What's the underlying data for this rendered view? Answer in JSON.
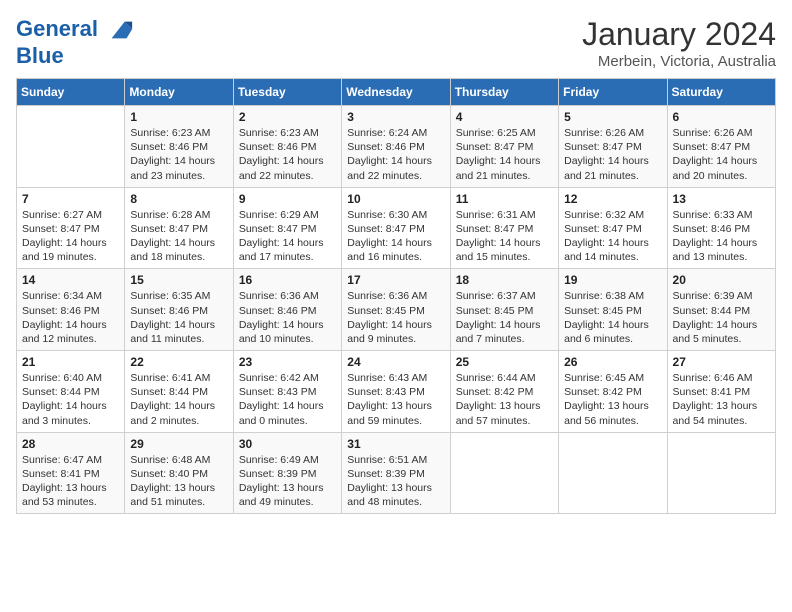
{
  "logo": {
    "line1": "General",
    "line2": "Blue"
  },
  "header": {
    "month": "January 2024",
    "location": "Merbein, Victoria, Australia"
  },
  "weekdays": [
    "Sunday",
    "Monday",
    "Tuesday",
    "Wednesday",
    "Thursday",
    "Friday",
    "Saturday"
  ],
  "weeks": [
    [
      {
        "day": "",
        "info": ""
      },
      {
        "day": "1",
        "info": "Sunrise: 6:23 AM\nSunset: 8:46 PM\nDaylight: 14 hours\nand 23 minutes."
      },
      {
        "day": "2",
        "info": "Sunrise: 6:23 AM\nSunset: 8:46 PM\nDaylight: 14 hours\nand 22 minutes."
      },
      {
        "day": "3",
        "info": "Sunrise: 6:24 AM\nSunset: 8:46 PM\nDaylight: 14 hours\nand 22 minutes."
      },
      {
        "day": "4",
        "info": "Sunrise: 6:25 AM\nSunset: 8:47 PM\nDaylight: 14 hours\nand 21 minutes."
      },
      {
        "day": "5",
        "info": "Sunrise: 6:26 AM\nSunset: 8:47 PM\nDaylight: 14 hours\nand 21 minutes."
      },
      {
        "day": "6",
        "info": "Sunrise: 6:26 AM\nSunset: 8:47 PM\nDaylight: 14 hours\nand 20 minutes."
      }
    ],
    [
      {
        "day": "7",
        "info": "Sunrise: 6:27 AM\nSunset: 8:47 PM\nDaylight: 14 hours\nand 19 minutes."
      },
      {
        "day": "8",
        "info": "Sunrise: 6:28 AM\nSunset: 8:47 PM\nDaylight: 14 hours\nand 18 minutes."
      },
      {
        "day": "9",
        "info": "Sunrise: 6:29 AM\nSunset: 8:47 PM\nDaylight: 14 hours\nand 17 minutes."
      },
      {
        "day": "10",
        "info": "Sunrise: 6:30 AM\nSunset: 8:47 PM\nDaylight: 14 hours\nand 16 minutes."
      },
      {
        "day": "11",
        "info": "Sunrise: 6:31 AM\nSunset: 8:47 PM\nDaylight: 14 hours\nand 15 minutes."
      },
      {
        "day": "12",
        "info": "Sunrise: 6:32 AM\nSunset: 8:47 PM\nDaylight: 14 hours\nand 14 minutes."
      },
      {
        "day": "13",
        "info": "Sunrise: 6:33 AM\nSunset: 8:46 PM\nDaylight: 14 hours\nand 13 minutes."
      }
    ],
    [
      {
        "day": "14",
        "info": "Sunrise: 6:34 AM\nSunset: 8:46 PM\nDaylight: 14 hours\nand 12 minutes."
      },
      {
        "day": "15",
        "info": "Sunrise: 6:35 AM\nSunset: 8:46 PM\nDaylight: 14 hours\nand 11 minutes."
      },
      {
        "day": "16",
        "info": "Sunrise: 6:36 AM\nSunset: 8:46 PM\nDaylight: 14 hours\nand 10 minutes."
      },
      {
        "day": "17",
        "info": "Sunrise: 6:36 AM\nSunset: 8:45 PM\nDaylight: 14 hours\nand 9 minutes."
      },
      {
        "day": "18",
        "info": "Sunrise: 6:37 AM\nSunset: 8:45 PM\nDaylight: 14 hours\nand 7 minutes."
      },
      {
        "day": "19",
        "info": "Sunrise: 6:38 AM\nSunset: 8:45 PM\nDaylight: 14 hours\nand 6 minutes."
      },
      {
        "day": "20",
        "info": "Sunrise: 6:39 AM\nSunset: 8:44 PM\nDaylight: 14 hours\nand 5 minutes."
      }
    ],
    [
      {
        "day": "21",
        "info": "Sunrise: 6:40 AM\nSunset: 8:44 PM\nDaylight: 14 hours\nand 3 minutes."
      },
      {
        "day": "22",
        "info": "Sunrise: 6:41 AM\nSunset: 8:44 PM\nDaylight: 14 hours\nand 2 minutes."
      },
      {
        "day": "23",
        "info": "Sunrise: 6:42 AM\nSunset: 8:43 PM\nDaylight: 14 hours\nand 0 minutes."
      },
      {
        "day": "24",
        "info": "Sunrise: 6:43 AM\nSunset: 8:43 PM\nDaylight: 13 hours\nand 59 minutes."
      },
      {
        "day": "25",
        "info": "Sunrise: 6:44 AM\nSunset: 8:42 PM\nDaylight: 13 hours\nand 57 minutes."
      },
      {
        "day": "26",
        "info": "Sunrise: 6:45 AM\nSunset: 8:42 PM\nDaylight: 13 hours\nand 56 minutes."
      },
      {
        "day": "27",
        "info": "Sunrise: 6:46 AM\nSunset: 8:41 PM\nDaylight: 13 hours\nand 54 minutes."
      }
    ],
    [
      {
        "day": "28",
        "info": "Sunrise: 6:47 AM\nSunset: 8:41 PM\nDaylight: 13 hours\nand 53 minutes."
      },
      {
        "day": "29",
        "info": "Sunrise: 6:48 AM\nSunset: 8:40 PM\nDaylight: 13 hours\nand 51 minutes."
      },
      {
        "day": "30",
        "info": "Sunrise: 6:49 AM\nSunset: 8:39 PM\nDaylight: 13 hours\nand 49 minutes."
      },
      {
        "day": "31",
        "info": "Sunrise: 6:51 AM\nSunset: 8:39 PM\nDaylight: 13 hours\nand 48 minutes."
      },
      {
        "day": "",
        "info": ""
      },
      {
        "day": "",
        "info": ""
      },
      {
        "day": "",
        "info": ""
      }
    ]
  ]
}
